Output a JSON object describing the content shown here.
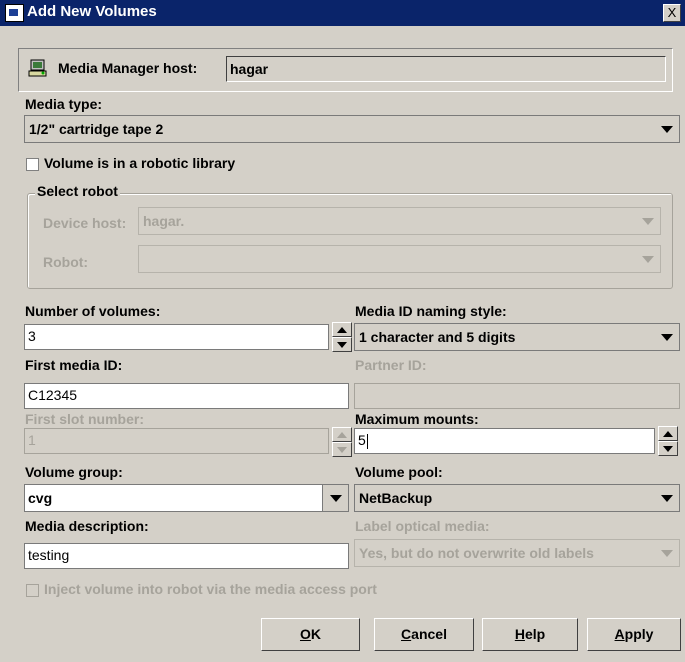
{
  "window": {
    "title": "Add New Volumes",
    "close_label": "X"
  },
  "host": {
    "label": "Media Manager host:",
    "value": "hagar",
    "icon": "host-computer-icon"
  },
  "media_type": {
    "label": "Media type:",
    "value": "1/2\" cartridge tape 2"
  },
  "robotic": {
    "label": "Volume is in a robotic library",
    "checked": false
  },
  "select_robot": {
    "title": "Select robot",
    "device_host_label": "Device host:",
    "device_host_value": "hagar.",
    "robot_label": "Robot:",
    "robot_value": ""
  },
  "num_volumes": {
    "label": "Number of volumes:",
    "value": "3"
  },
  "naming_style": {
    "label": "Media ID naming style:",
    "value": "1 character and 5 digits"
  },
  "first_media_id": {
    "label": "First media ID:",
    "value": "C12345"
  },
  "partner_id": {
    "label": "Partner ID:",
    "value": ""
  },
  "first_slot": {
    "label": "First slot number:",
    "value": "1"
  },
  "max_mounts": {
    "label": "Maximum mounts:",
    "value": "5"
  },
  "volume_group": {
    "label": "Volume group:",
    "value": "cvg"
  },
  "volume_pool": {
    "label": "Volume pool:",
    "value": "NetBackup"
  },
  "media_description": {
    "label": "Media description:",
    "value": "testing"
  },
  "label_optical": {
    "label": "Label optical media:",
    "value": "Yes, but do not overwrite old labels"
  },
  "inject": {
    "label": "Inject volume into robot via the media access port",
    "checked": false
  },
  "buttons": {
    "ok": {
      "mnemonic": "O",
      "rest": "K"
    },
    "cancel": {
      "mnemonic": "C",
      "rest": "ancel"
    },
    "help": {
      "mnemonic": "H",
      "rest": "elp"
    },
    "apply": {
      "mnemonic": "A",
      "rest": "pply"
    }
  },
  "colors": {
    "title_bar": "#0a246a",
    "dialog_bg": "#d4d0c8",
    "disabled_text": "#a6a39b"
  }
}
